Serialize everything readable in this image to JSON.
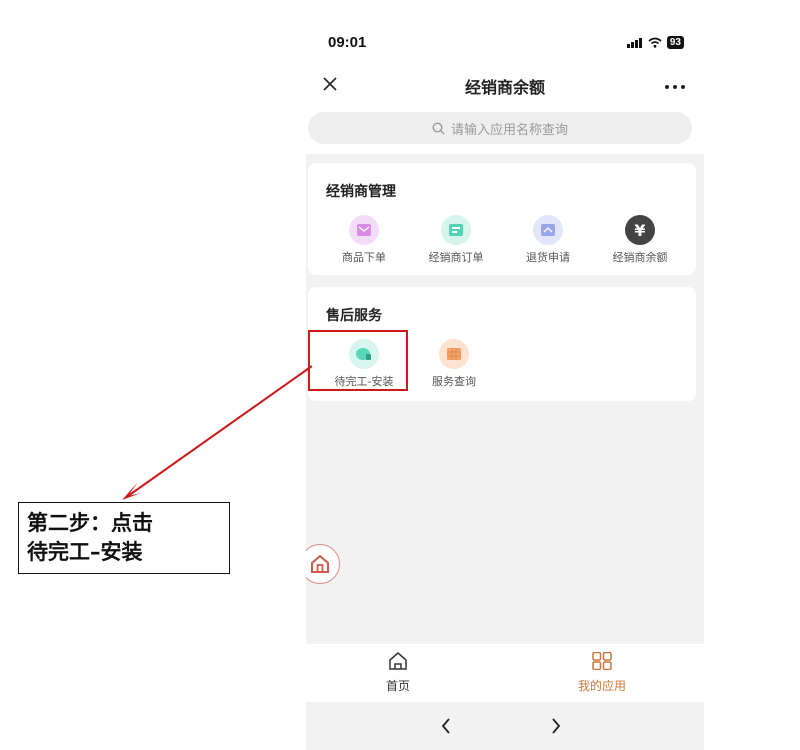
{
  "status_bar": {
    "time": "09:01",
    "battery": "93"
  },
  "nav": {
    "title": "经销商余额"
  },
  "search": {
    "placeholder": "请输入应用名称查询"
  },
  "sections": [
    {
      "title": "经销商管理",
      "apps": [
        {
          "label": "商品下单",
          "icon": "order-icon",
          "color": "#e7b6f0"
        },
        {
          "label": "经销商订单",
          "icon": "dealer-order-icon",
          "color": "#55d1b5"
        },
        {
          "label": "退货申请",
          "icon": "return-request-icon",
          "color": "#9aa6e8"
        },
        {
          "label": "经销商余额",
          "icon": "yen-icon",
          "color": "#444444"
        }
      ]
    },
    {
      "title": "售后服务",
      "apps": [
        {
          "label": "待完工-安装",
          "icon": "install-icon",
          "color": "#57d6b8"
        },
        {
          "label": "服务查询",
          "icon": "service-query-icon",
          "color": "#f2a36a"
        }
      ]
    }
  ],
  "tabbar": {
    "home_label": "首页",
    "apps_label": "我的应用",
    "active_color": "#c8773a"
  },
  "annotation": {
    "line1": "第二步：点击",
    "line2": "待完工–安装",
    "color": "#cc1a1a"
  }
}
